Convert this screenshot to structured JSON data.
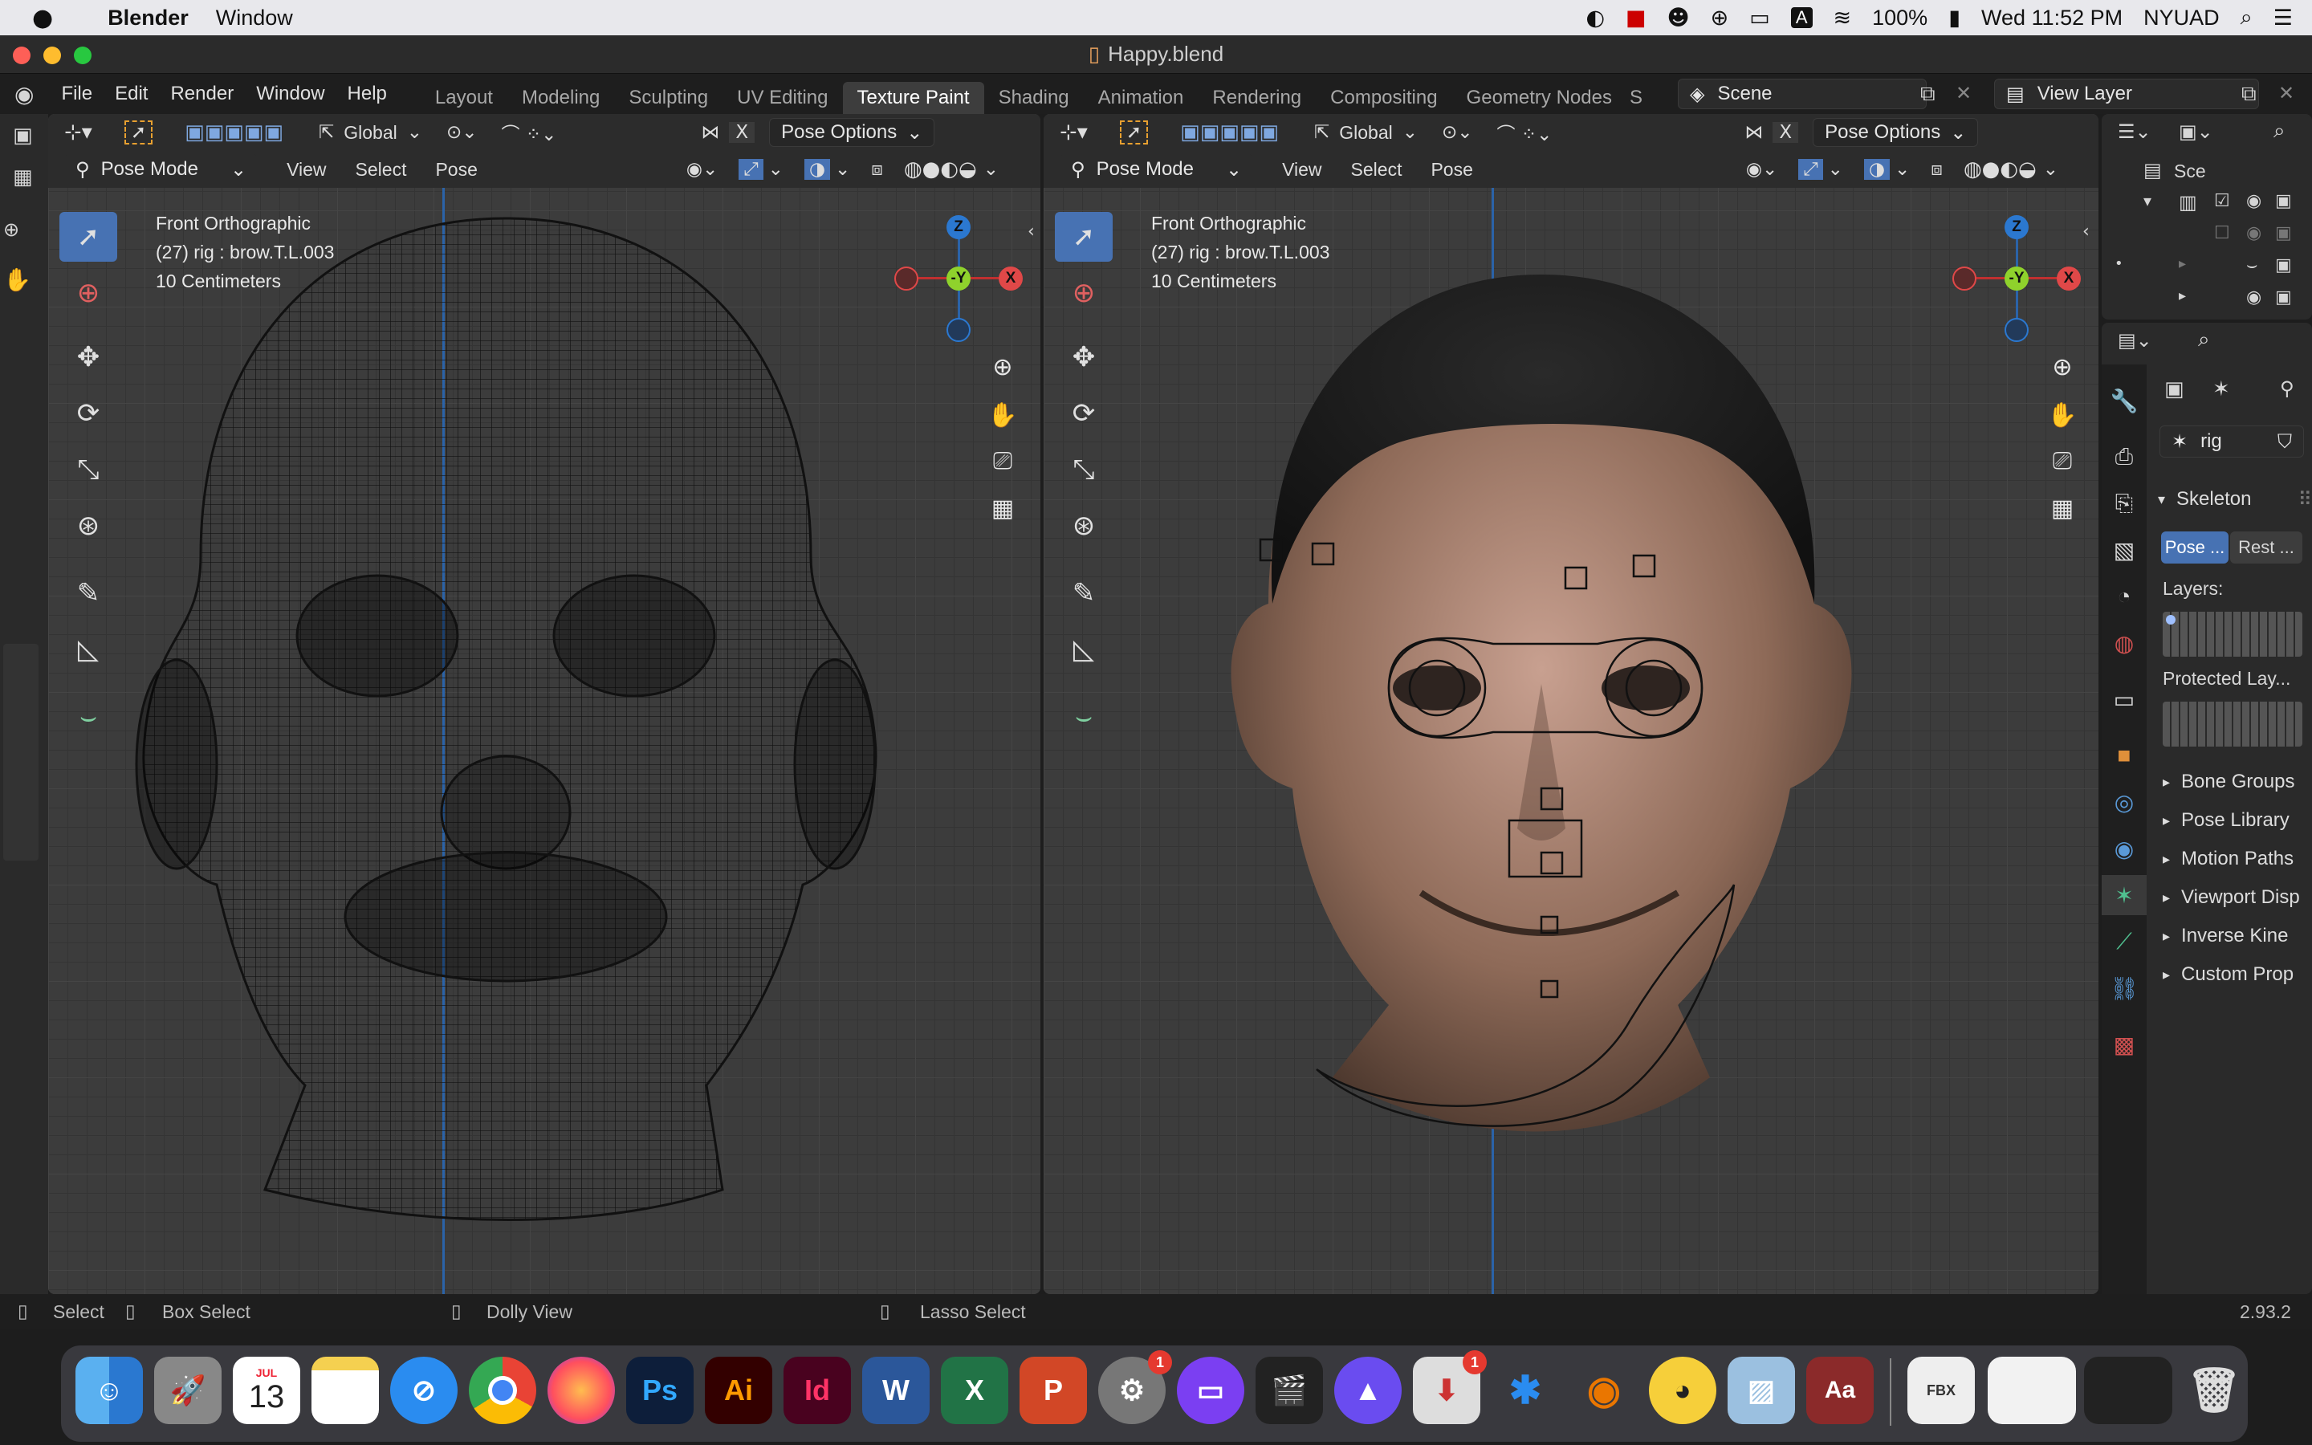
{
  "menubar": {
    "apple": "",
    "app": "Blender",
    "menu": "Window",
    "battery": "100%",
    "clock": "Wed 11:52 PM",
    "user": "NYUAD",
    "input_letter": "A"
  },
  "window": {
    "title": "Happy.blend"
  },
  "topbar": {
    "menus": [
      "File",
      "Edit",
      "Render",
      "Window",
      "Help"
    ],
    "workspaces": [
      "Layout",
      "Modeling",
      "Sculpting",
      "UV Editing",
      "Texture Paint",
      "Shading",
      "Animation",
      "Rendering",
      "Compositing",
      "Geometry Nodes",
      "S"
    ],
    "active_workspace": "Texture Paint",
    "scene": "Scene",
    "view_layer": "View Layer"
  },
  "left_viewport": {
    "transform": "Global",
    "pose_options": "Pose Options",
    "mode": "Pose Mode",
    "menus": [
      "View",
      "Select",
      "Pose"
    ],
    "info": [
      "Front Orthographic",
      "(27) rig : brow.T.L.003",
      "10 Centimeters"
    ]
  },
  "right_viewport": {
    "transform": "Global",
    "pose_options": "Pose Options",
    "mode": "Pose Mode",
    "menus": [
      "View",
      "Select",
      "Pose"
    ],
    "info": [
      "Front Orthographic",
      "(27) rig : brow.T.L.003",
      "10 Centimeters"
    ]
  },
  "gizmo": {
    "z": "Z",
    "y": "-Y",
    "x": "X"
  },
  "outliner": {
    "label": "Sce"
  },
  "properties": {
    "object_name": "rig",
    "section": "Skeleton",
    "pose_btn": "Pose ...",
    "rest_btn": "Rest ...",
    "layers_label": "Layers:",
    "protected_label": "Protected Lay...",
    "panels": [
      "Bone Groups",
      "Pose Library",
      "Motion Paths",
      "Viewport Disp",
      "Inverse Kine",
      "Custom Prop"
    ]
  },
  "statusbar": {
    "select": "Select",
    "box_select": "Box Select",
    "dolly": "Dolly View",
    "lasso": "Lasso Select",
    "version": "2.93.2"
  },
  "dock": {
    "calendar_month": "JUL",
    "calendar_day": "13",
    "apps": [
      "Finder",
      "Launchpad",
      "Calendar",
      "Notes",
      "Safari",
      "Chrome",
      "Firefox",
      "Ps",
      "Ai",
      "Id",
      "W",
      "X",
      "P",
      "System Preferences",
      "Screen Recorder",
      "Final Cut",
      "Affinity",
      "Installer",
      "Bluetooth",
      "Blender",
      "Cyberduck",
      "Preview",
      "Dictionary",
      "FBX",
      "Screenshot",
      "Terminal",
      "Trash"
    ],
    "badges": {
      "system_prefs": "1",
      "installer": "1"
    }
  }
}
